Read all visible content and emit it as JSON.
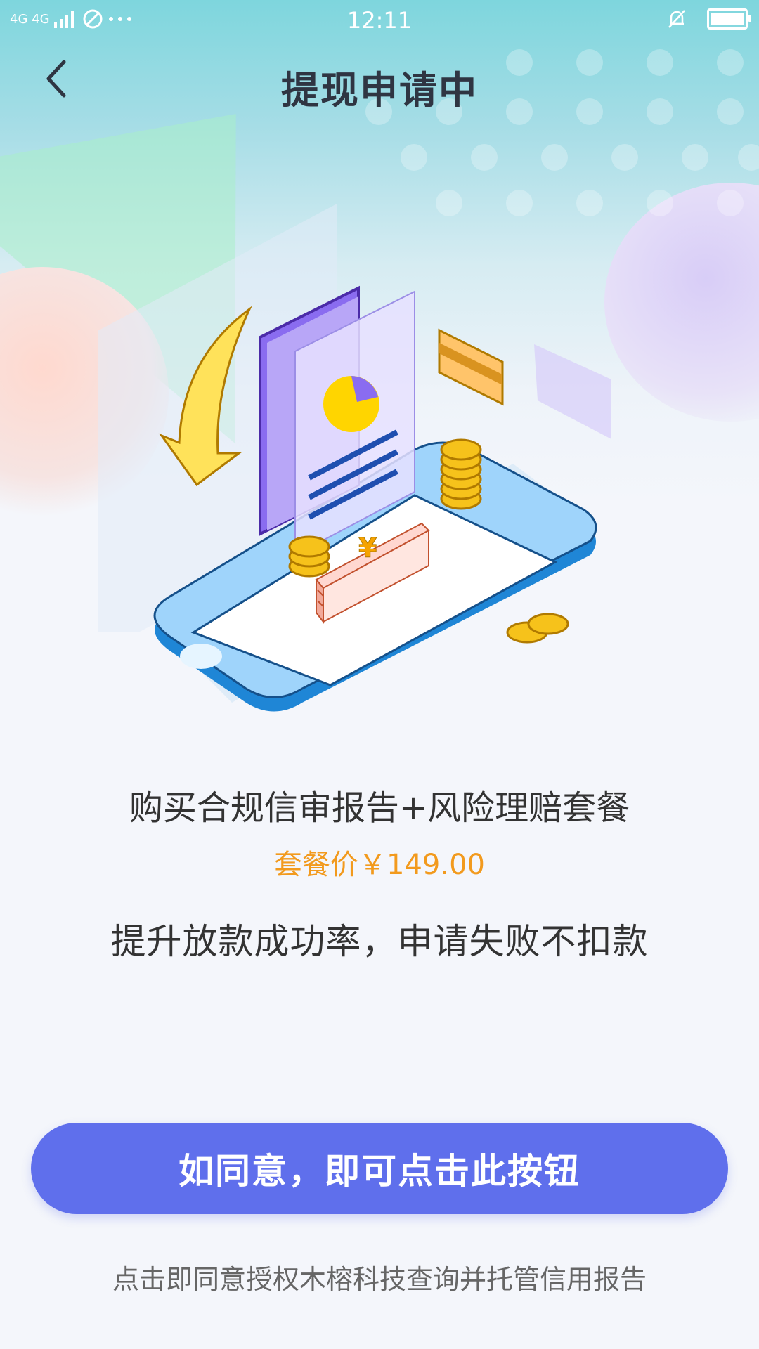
{
  "statusbar": {
    "network": "4G 4G",
    "time": "12:11"
  },
  "navbar": {
    "title": "提现申请中"
  },
  "illustration": {
    "currency_symbol": "¥"
  },
  "content": {
    "package_title": "购买合规信审报告+风险理赔套餐",
    "package_price": "套餐价￥149.00",
    "benefit_text": "提升放款成功率，申请失败不扣款"
  },
  "cta": {
    "label": "如同意，即可点击此按钮"
  },
  "footer": {
    "consent_text": "点击即同意授权木榕科技查询并托管信用报告"
  },
  "colors": {
    "accent": "#5f6fec",
    "price": "#f29a1d"
  }
}
